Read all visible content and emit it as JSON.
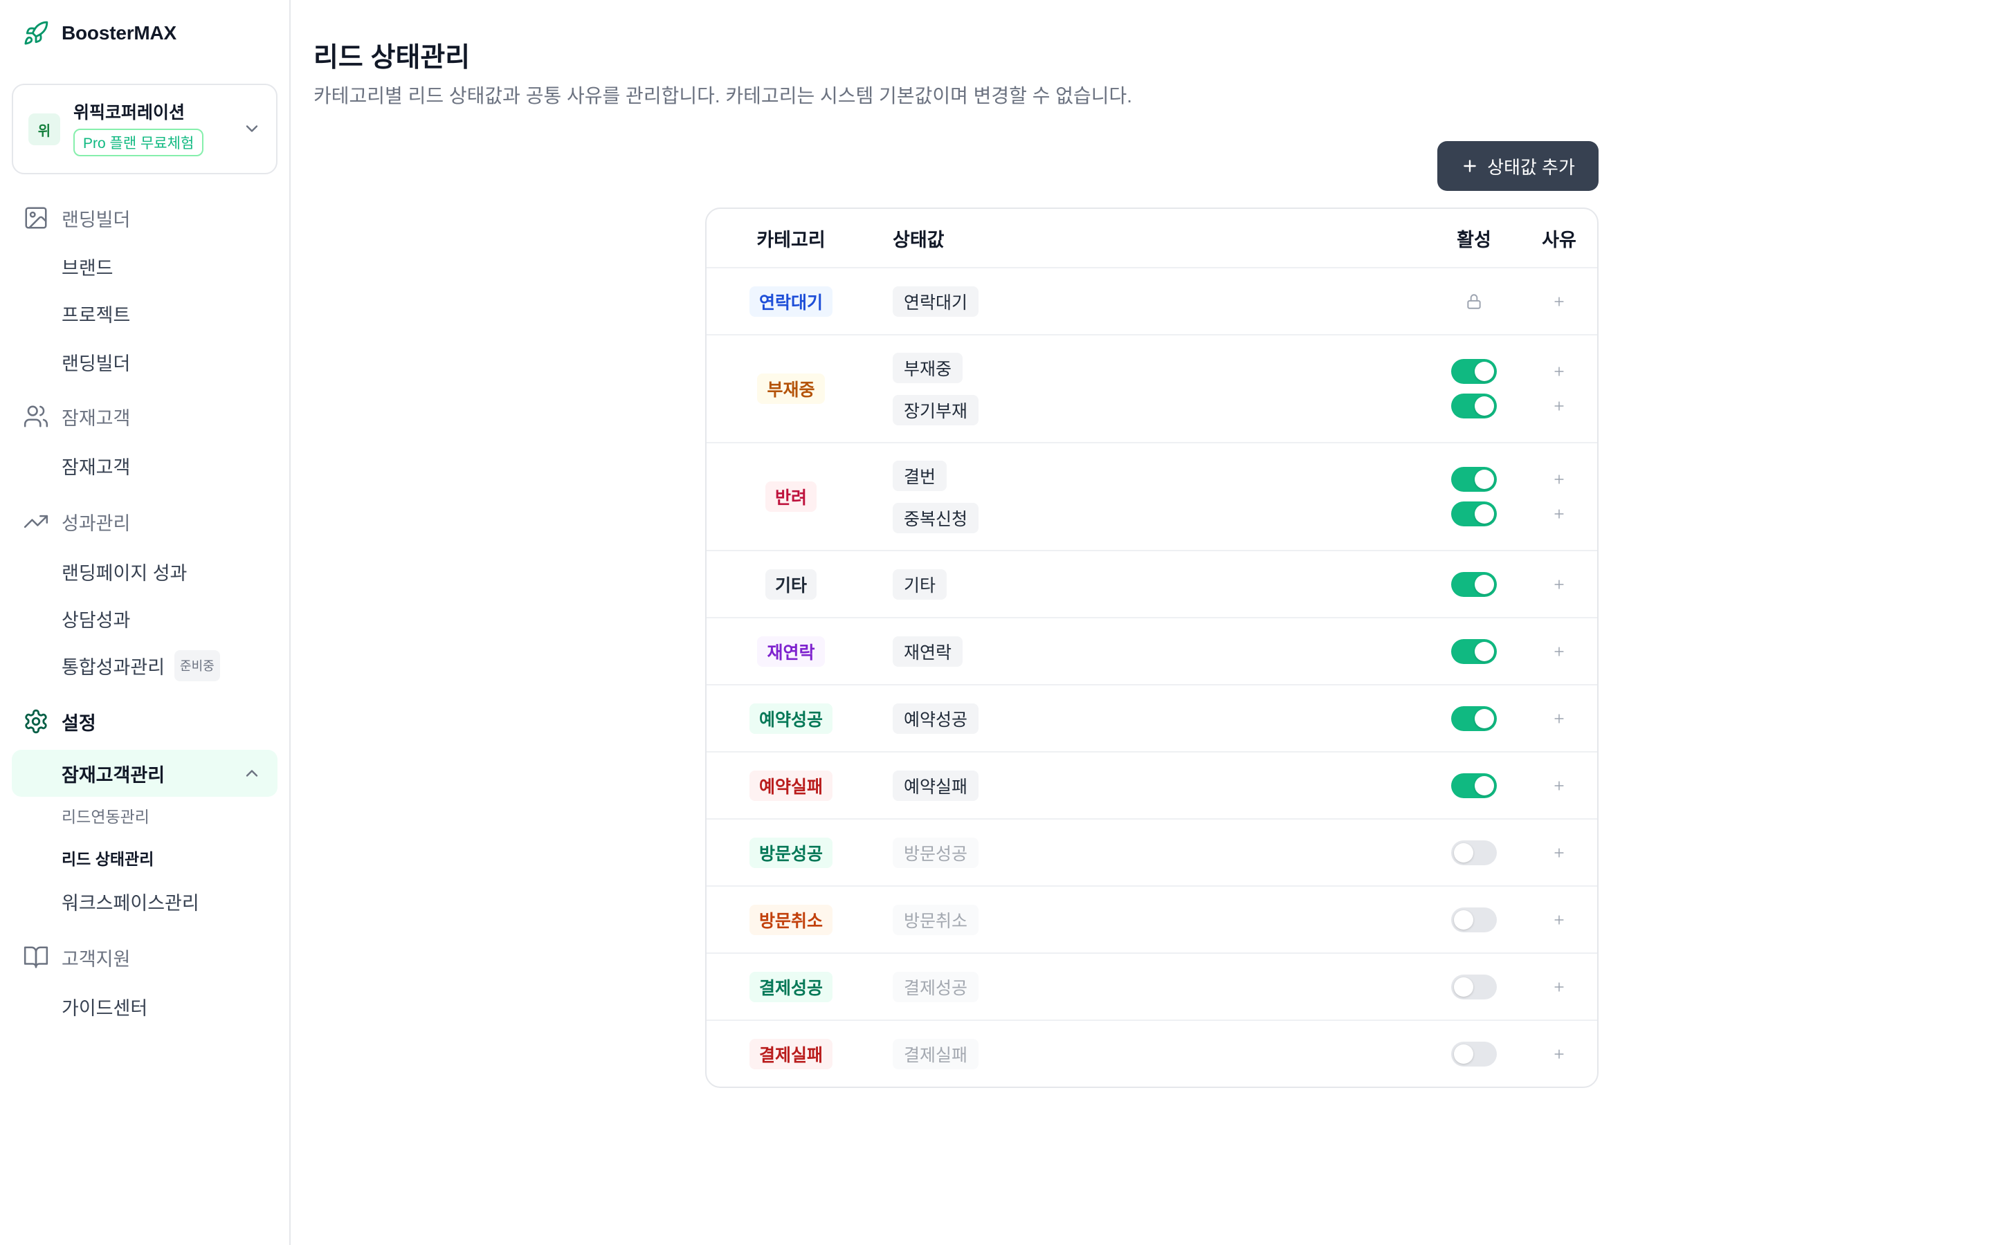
{
  "theme": {
    "accent": "#10b981",
    "brand": "#059669",
    "button_bg": "#374151",
    "highlight": "#ecfdf5"
  },
  "palette": {
    "blue": {
      "text": "#1d4ed8",
      "bg": "#eff6ff"
    },
    "amber": {
      "text": "#b45309",
      "bg": "#fffbeb"
    },
    "rose": {
      "text": "#be123c",
      "bg": "#fff1f2"
    },
    "gray": {
      "text": "#1f2937",
      "bg": "#f3f4f6"
    },
    "purple": {
      "text": "#7e22ce",
      "bg": "#faf5ff"
    },
    "green": {
      "text": "#047857",
      "bg": "#ecfdf5"
    },
    "red": {
      "text": "#b91c1c",
      "bg": "#fef2f2"
    },
    "orange": {
      "text": "#c2410c",
      "bg": "#fff7ed"
    }
  },
  "app": {
    "name": "BoosterMAX",
    "logo_icon": "rocket-icon"
  },
  "org": {
    "initial": "위",
    "name": "위픽코퍼레이션",
    "plan_badge": "Pro 플랜 무료체험",
    "switch_icon": "chevron-down-icon"
  },
  "sidebar": {
    "sections": [
      {
        "label": "랜딩빌더",
        "icon": "image-icon",
        "items": [
          {
            "label": "브랜드"
          },
          {
            "label": "프로젝트"
          },
          {
            "label": "랜딩빌더"
          }
        ]
      },
      {
        "label": "잠재고객",
        "icon": "users-icon",
        "items": [
          {
            "label": "잠재고객"
          }
        ]
      },
      {
        "label": "성과관리",
        "icon": "trending-up-icon",
        "items": [
          {
            "label": "랜딩페이지 성과"
          },
          {
            "label": "상담성과"
          },
          {
            "label": "통합성과관리",
            "badge": "준비중"
          }
        ]
      },
      {
        "label": "설정",
        "icon": "gear-icon",
        "active": true,
        "items": [
          {
            "label": "잠재고객관리",
            "expanded": true,
            "icon": "chevron-up-icon",
            "children": [
              {
                "label": "리드연동관리"
              },
              {
                "label": "리드 상태관리",
                "current": true
              }
            ]
          },
          {
            "label": "워크스페이스관리"
          }
        ]
      },
      {
        "label": "고객지원",
        "icon": "book-open-icon",
        "items": [
          {
            "label": "가이드센터"
          }
        ]
      }
    ]
  },
  "page": {
    "title": "리드 상태관리",
    "subtitle": "카테고리별 리드 상태값과 공통 사유를 관리합니다. 카테고리는 시스템 기본값이며 변경할 수 없습니다."
  },
  "actions": {
    "add_status": {
      "label": "상태값 추가",
      "icon": "plus-icon"
    }
  },
  "table": {
    "headers": {
      "category": "카테고리",
      "status": "상태값",
      "active": "활성",
      "reason": "사유"
    },
    "reason_icon": "plus-icon",
    "rows": [
      {
        "category": "연락대기",
        "tone": "blue",
        "locked": true,
        "statuses": [
          {
            "label": "연락대기",
            "active": true
          }
        ]
      },
      {
        "category": "부재중",
        "tone": "amber",
        "statuses": [
          {
            "label": "부재중",
            "active": true
          },
          {
            "label": "장기부재",
            "active": true
          }
        ]
      },
      {
        "category": "반려",
        "tone": "rose",
        "statuses": [
          {
            "label": "결번",
            "active": true
          },
          {
            "label": "중복신청",
            "active": true
          }
        ]
      },
      {
        "category": "기타",
        "tone": "gray",
        "statuses": [
          {
            "label": "기타",
            "active": true
          }
        ]
      },
      {
        "category": "재연락",
        "tone": "purple",
        "statuses": [
          {
            "label": "재연락",
            "active": true
          }
        ]
      },
      {
        "category": "예약성공",
        "tone": "green",
        "statuses": [
          {
            "label": "예약성공",
            "active": true
          }
        ]
      },
      {
        "category": "예약실패",
        "tone": "red",
        "statuses": [
          {
            "label": "예약실패",
            "active": true
          }
        ]
      },
      {
        "category": "방문성공",
        "tone": "green",
        "statuses": [
          {
            "label": "방문성공",
            "active": false
          }
        ]
      },
      {
        "category": "방문취소",
        "tone": "orange",
        "statuses": [
          {
            "label": "방문취소",
            "active": false
          }
        ]
      },
      {
        "category": "결제성공",
        "tone": "green",
        "statuses": [
          {
            "label": "결제성공",
            "active": false
          }
        ]
      },
      {
        "category": "결제실패",
        "tone": "red",
        "statuses": [
          {
            "label": "결제실패",
            "active": false
          }
        ]
      }
    ]
  }
}
